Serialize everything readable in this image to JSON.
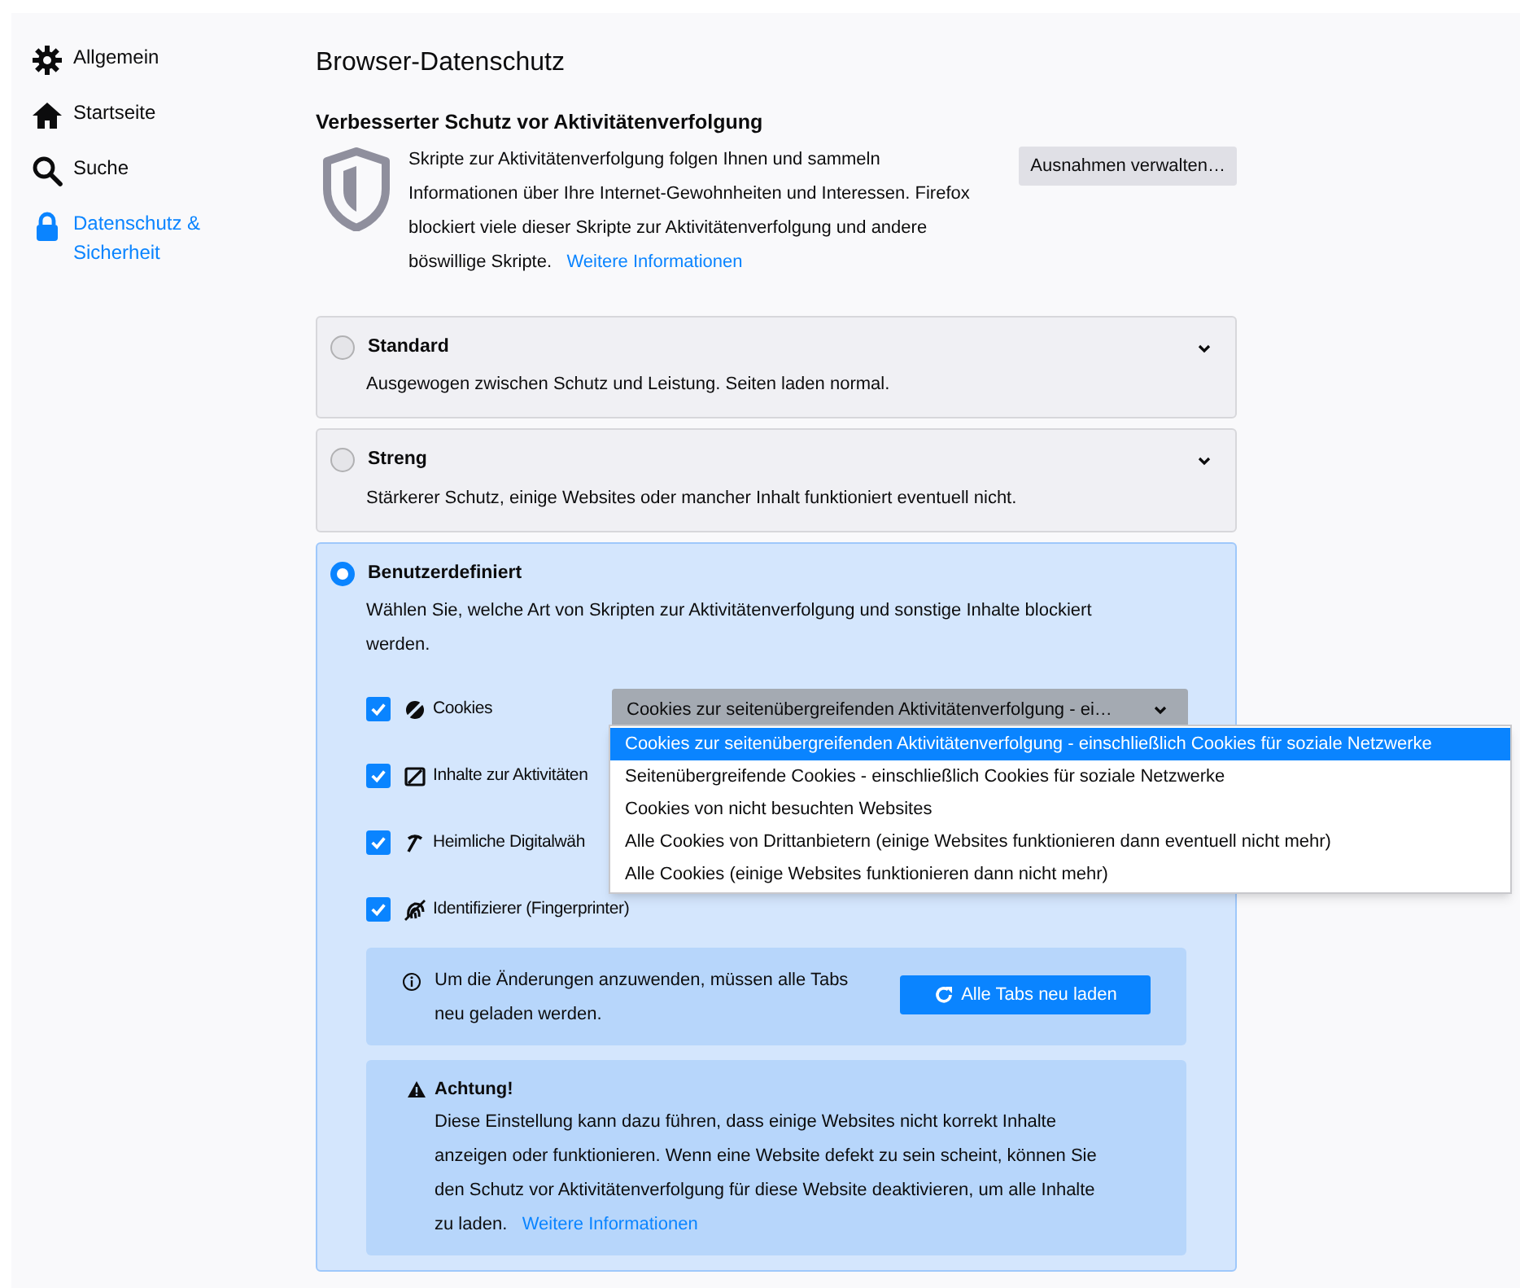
{
  "sidebar": {
    "items": [
      {
        "label": "Allgemein",
        "kind": "gear",
        "selected": false
      },
      {
        "label": "Startseite",
        "kind": "home",
        "selected": false
      },
      {
        "label": "Suche",
        "kind": "search",
        "selected": false
      },
      {
        "label": "Datenschutz & Sicherheit",
        "kind": "lock",
        "selected": true
      }
    ]
  },
  "page_title": "Browser-Datenschutz",
  "section": {
    "heading": "Verbesserter Schutz vor Aktivitätenverfolgung",
    "description": "Skripte zur Aktivitätenverfolgung folgen Ihnen und sammeln Informationen über Ihre Internet-Gewohnheiten und Interessen. Firefox blockiert viele dieser Skripte zur Aktivitätenverfolgung und andere böswillige Skripte.",
    "link": "Weitere Informationen",
    "button": "Ausnahmen verwalten…"
  },
  "options": [
    {
      "title": "Standard",
      "description": "Ausgewogen zwischen Schutz und Leistung. Seiten laden normal.",
      "selected": false
    },
    {
      "title": "Streng",
      "description": "Stärkerer Schutz, einige Websites oder mancher Inhalt funktioniert eventuell nicht.",
      "selected": false
    },
    {
      "title": "Benutzerdefiniert",
      "description": "Wählen Sie, welche Art von Skripten zur Aktivitätenverfolgung und sonstige Inhalte blockiert werden.",
      "selected": true
    }
  ],
  "custom": {
    "checkboxes": [
      {
        "label": "Cookies",
        "kind": "cookies",
        "checked": true
      },
      {
        "label": "Inhalte zur Aktivitäten",
        "kind": "content",
        "checked": true
      },
      {
        "label": "Heimliche Digitalwäh",
        "kind": "miner",
        "checked": true
      },
      {
        "label": "Identifizierer (Fingerprinter)",
        "kind": "fingerprint",
        "checked": true
      }
    ],
    "cookie_select": {
      "value": "Cookies zur seitenübergreifenden Aktivitätenverfolgung - ei…",
      "options": [
        {
          "label": "Cookies zur seitenübergreifenden Aktivitätenverfolgung - einschließlich Cookies für soziale Netzwerke",
          "selected": true
        },
        {
          "label": "Seitenübergreifende Cookies - einschließlich Cookies für soziale Netzwerke",
          "selected": false
        },
        {
          "label": "Cookies von nicht besuchten Websites",
          "selected": false
        },
        {
          "label": "Alle Cookies von Drittanbietern (einige Websites funktionieren dann eventuell nicht mehr)",
          "selected": false
        },
        {
          "label": "Alle Cookies (einige Websites funktionieren dann nicht mehr)",
          "selected": false
        }
      ]
    },
    "reload_notice": {
      "text": "Um die Änderungen anzuwenden, müssen alle Tabs neu geladen werden.",
      "button": "Alle Tabs neu laden"
    },
    "warning": {
      "title": "Achtung!",
      "text": "Diese Einstellung kann dazu führen, dass einige Websites nicht korrekt Inhalte anzeigen oder funktionieren. Wenn eine Website defekt zu sein scheint, können Sie den Schutz vor Aktivitätenverfolgung für diese Website deaktivieren, um alle Inhalte zu laden.",
      "link": "Weitere Informationen"
    }
  }
}
